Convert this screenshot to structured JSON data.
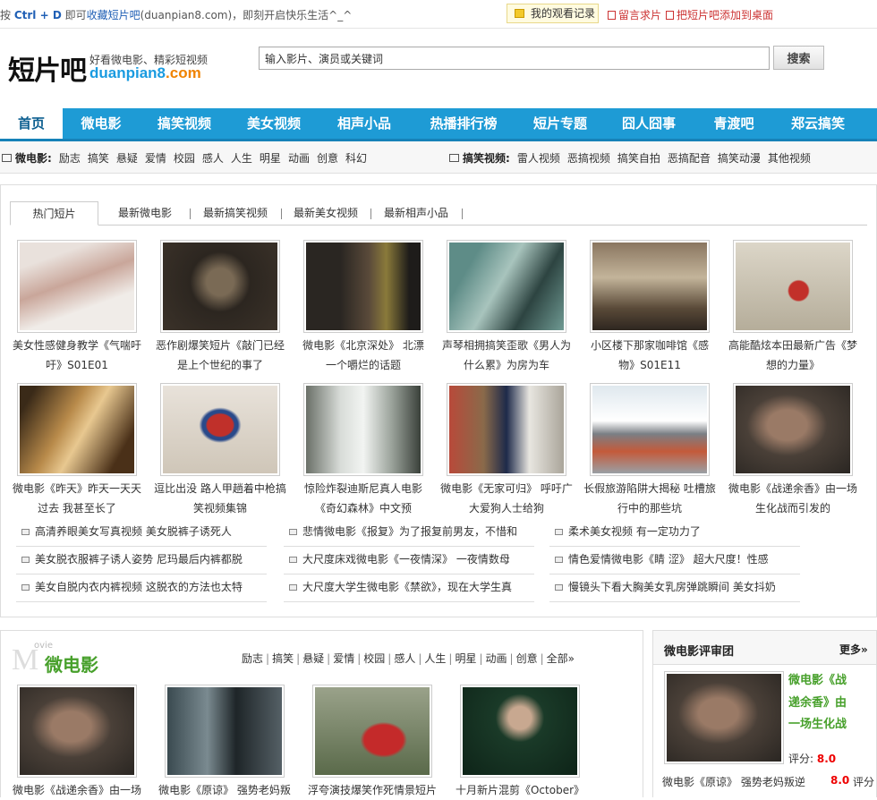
{
  "topbar": {
    "prefix": "按 ",
    "shortcut": "Ctrl + D",
    "mid": " 即可",
    "fav_link": "收藏短片吧",
    "rest": "(duanpian8.com)，即刻开启快乐生活^_^",
    "history": "我的观看记录",
    "message": "留言求片",
    "desktop": "把短片吧添加到桌面"
  },
  "logo": {
    "cn": "短片吧",
    "tagline": "好看微电影、精彩短视频",
    "domain_a": "duanpian8",
    "domain_b": ".com"
  },
  "search": {
    "placeholder": "输入影片、演员或关键词",
    "button": "搜索"
  },
  "nav": [
    "首页",
    "微电影",
    "搞笑视频",
    "美女视频",
    "相声小品",
    "热播排行榜",
    "短片专题",
    "囧人囧事",
    "青渡吧",
    "郑云搞笑"
  ],
  "subnav": {
    "movie_title": "微电影:",
    "movie_items": [
      "励志",
      "搞笑",
      "悬疑",
      "爱情",
      "校园",
      "感人",
      "人生",
      "明星",
      "动画",
      "创意",
      "科幻"
    ],
    "funny_title": "搞笑视频:",
    "funny_items": [
      "雷人视频",
      "恶搞视频",
      "搞笑自拍",
      "恶搞配音",
      "搞笑动漫",
      "其他视频"
    ]
  },
  "tabs": [
    "热门短片",
    "最新微电影",
    "最新搞笑视频",
    "最新美女视频",
    "最新相声小品"
  ],
  "cards": [
    {
      "l1": "美女性感健身教学《气喘吁",
      "l2": "吁》S01E01"
    },
    {
      "l1": "恶作剧爆笑短片《敲门已经",
      "l2": "是上个世纪的事了"
    },
    {
      "l1": "微电影《北京深处》 北漂",
      "l2": "一个嚼烂的话题"
    },
    {
      "l1": "声琴相拥搞笑歪歌《男人为",
      "l2": "什么累》为房为车"
    },
    {
      "l1": "小区楼下那家咖啡馆《感",
      "l2": "物》S01E11"
    },
    {
      "l1": "高能酷炫本田最新广告《梦",
      "l2": "想的力量》"
    },
    {
      "l1": "微电影《昨天》昨天一天天",
      "l2": "过去 我甚至长了"
    },
    {
      "l1": "逗比出没 路人甲趟着中枪搞",
      "l2": "笑视频集锦"
    },
    {
      "l1": "惊险炸裂迪斯尼真人电影",
      "l2": "《奇幻森林》中文预"
    },
    {
      "l1": "微电影《无家可归》 呼吁广",
      "l2": "大爱狗人士给狗"
    },
    {
      "l1": "长假旅游陷阱大揭秘 吐槽旅",
      "l2": "行中的那些坑"
    },
    {
      "l1": "微电影《战递余香》由一场",
      "l2": "生化战而引发的"
    }
  ],
  "lists": [
    "高清养眼美女写真视频 美女脱裤子诱死人",
    "悲情微电影《报复》为了报复前男友，不惜和",
    "柔术美女视频 有一定功力了",
    "美女脱衣服裤子诱人姿势 尼玛最后内裤都脱",
    "大尺度床戏微电影《一夜情深》 一夜情数母",
    "情色爱情微电影《睛 涩》 超大尺度！性感",
    "美女自脱内衣内裤视频 这脱衣的方法也太特",
    "大尺度大学生微电影《禁欲》，现在大学生真",
    "慢镜头下看大胸美女乳房弹跳瞬间 美女抖奶"
  ],
  "movie": {
    "big": "M",
    "small": "ovie",
    "title": "微电影",
    "cats": [
      "励志",
      "搞笑",
      "悬疑",
      "爱情",
      "校园",
      "感人",
      "人生",
      "明星",
      "动画",
      "创意",
      "全部»"
    ],
    "cards": [
      "微电影《战递余香》由一场",
      "微电影《原谅》 强势老妈叛",
      "浮夸演技爆笑作死情景短片",
      "十月新片混剪《October》"
    ]
  },
  "jury": {
    "title": "微电影评审团",
    "more": "更多»",
    "film_title": "微电影《战递余香》由一场生化战",
    "score_label": "评分:",
    "score": "8.0",
    "item": "微电影《原谅》 强势老妈叛逆",
    "item_score": "8.0",
    "item_label": "评分"
  },
  "colors": {
    "nav": "#1e9bd5",
    "accent_green": "#47a02b",
    "link_blue": "#1f5fb5",
    "red": "#c33"
  }
}
